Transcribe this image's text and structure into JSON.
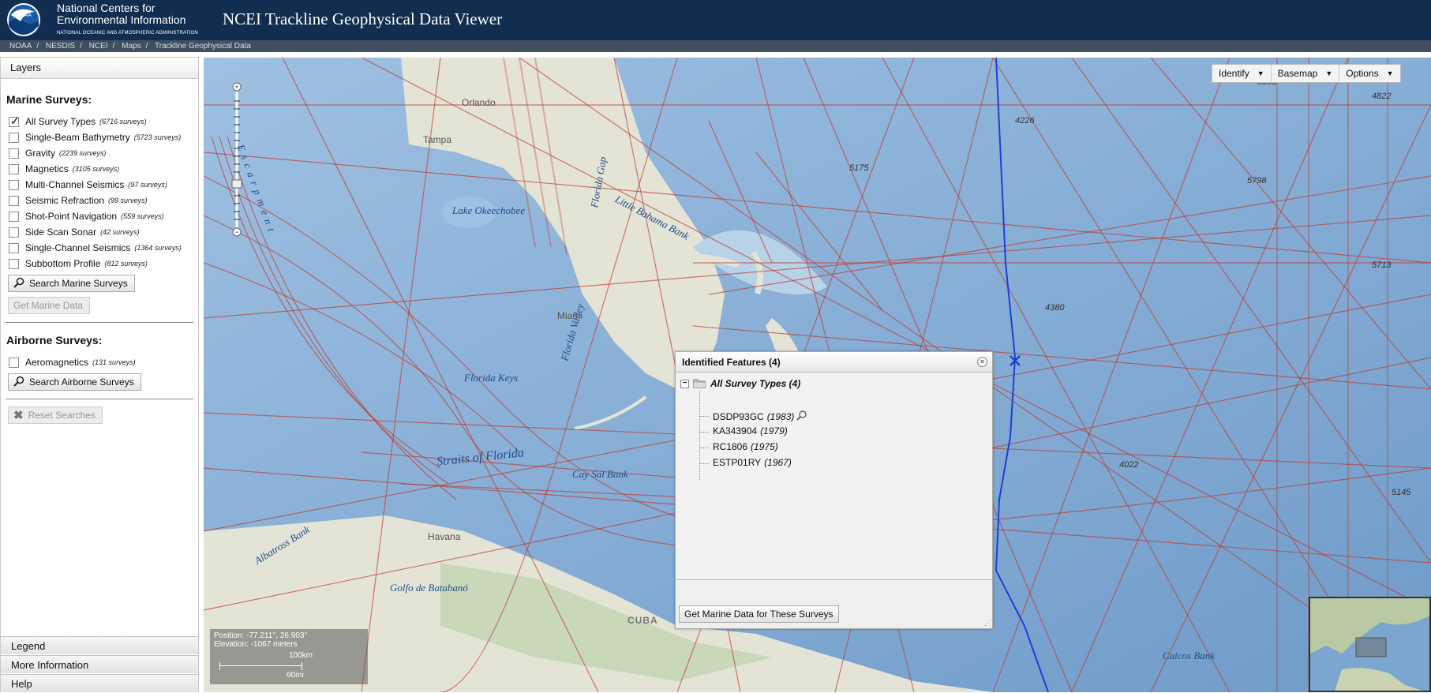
{
  "header": {
    "logo_text": "NOAA",
    "org_line1": "National Centers for",
    "org_line2": "Environmental Information",
    "org_sub": "NATIONAL OCEANIC AND ATMOSPHERIC ADMINISTRATION",
    "title": "NCEI Trackline Geophysical Data Viewer"
  },
  "breadcrumb": [
    "NOAA",
    "NESDIS",
    "NCEI",
    "Maps",
    "Trackline Geophysical Data"
  ],
  "sidebar": {
    "layers_title": "Layers",
    "marine_title": "Marine Surveys:",
    "marine_items": [
      {
        "label": "All Survey Types",
        "count": "(6716 surveys)",
        "checked": true
      },
      {
        "label": "Single-Beam Bathymetry",
        "count": "(5723 surveys)",
        "checked": false
      },
      {
        "label": "Gravity",
        "count": "(2239 surveys)",
        "checked": false
      },
      {
        "label": "Magnetics",
        "count": "(3105 surveys)",
        "checked": false
      },
      {
        "label": "Multi-Channel Seismics",
        "count": "(97 surveys)",
        "checked": false
      },
      {
        "label": "Seismic Refraction",
        "count": "(99 surveys)",
        "checked": false
      },
      {
        "label": "Shot-Point Navigation",
        "count": "(559 surveys)",
        "checked": false
      },
      {
        "label": "Side Scan Sonar",
        "count": "(42 surveys)",
        "checked": false
      },
      {
        "label": "Single-Channel Seismics",
        "count": "(1364 surveys)",
        "checked": false
      },
      {
        "label": "Subbottom Profile",
        "count": "(812 surveys)",
        "checked": false
      }
    ],
    "search_marine": "Search Marine Surveys",
    "get_marine": "Get Marine Data",
    "airborne_title": "Airborne Surveys:",
    "airborne_items": [
      {
        "label": "Aeromagnetics",
        "count": "(131 surveys)",
        "checked": false
      }
    ],
    "search_airborne": "Search Airborne Surveys",
    "reset": "Reset Searches",
    "accordion": [
      "Legend",
      "More Information",
      "Help"
    ]
  },
  "toolbar": {
    "identify": "Identify",
    "basemap": "Basemap",
    "options": "Options"
  },
  "map_labels": {
    "water": [
      "Lake Okeechobee",
      "Florida Keys",
      "Straits of Florida",
      "Little Bahama Bank",
      "Florida Gap",
      "Florida Valley",
      "Cay Sal Bank",
      "Golfo de Batabanó",
      "Albatross Bank",
      "Escarpment",
      "Caicos Bank"
    ],
    "places": [
      "Orlando",
      "Tampa",
      "Miami",
      "Havana",
      "CUBA"
    ],
    "depths": [
      "4226",
      "5175",
      "5798",
      "4822",
      "5713",
      "4380",
      "4022",
      "5145",
      "5565"
    ]
  },
  "readout": {
    "position": "Position: -77.211°, 26.903°",
    "elevation": "Elevation: -1067 meters",
    "scale_km": "100km",
    "scale_mi": "60mi"
  },
  "popup": {
    "title": "Identified Features (4)",
    "root": "All Survey Types (4)",
    "items": [
      {
        "id": "DSDP93GC",
        "year": "(1983)"
      },
      {
        "id": "KA343904",
        "year": "(1979)"
      },
      {
        "id": "RC1806",
        "year": "(1975)"
      },
      {
        "id": "ESTP01RY",
        "year": "(1967)"
      }
    ],
    "button": "Get Marine Data for These Surveys"
  },
  "colors": {
    "header_bg": "#112e51",
    "track_red": "#c0392b",
    "selected_track": "#1f3fd6"
  }
}
